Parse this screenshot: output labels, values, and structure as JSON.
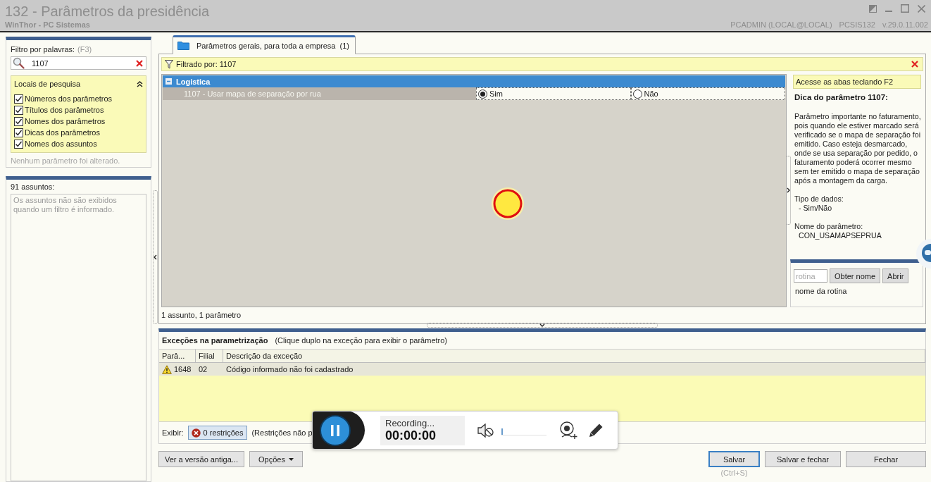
{
  "window": {
    "title": "132 - Parâmetros da presidência",
    "subtitle": "WinThor - PC Sistemas",
    "session": "PCADMIN (LOCAL@LOCAL)",
    "program": "PCSIS132",
    "version": "v.29.0.11.002"
  },
  "filter_panel": {
    "label": "Filtro por palavras:",
    "shortcut": "(F3)",
    "search": {
      "value": "1107"
    },
    "locations": {
      "title": "Locais de pesquisa",
      "expanded": true,
      "items": [
        {
          "label": "Números dos parâmetros",
          "checked": true
        },
        {
          "label": "Títulos dos parâmetros",
          "checked": true
        },
        {
          "label": "Nomes dos parâmetros",
          "checked": true
        },
        {
          "label": "Dicas dos parâmetros",
          "checked": true
        },
        {
          "label": "Nomes dos assuntos",
          "checked": true
        }
      ]
    },
    "status": "Nenhum parâmetro foi alterado."
  },
  "subjects_panel": {
    "count_label": "91 assuntos:",
    "placeholder": "Os assuntos não são exibidos quando um filtro é informado."
  },
  "tabs": [
    {
      "label": "Parâmetros gerais, para toda a empresa",
      "count": "(1)",
      "selected": true
    }
  ],
  "filter_bar": {
    "text": "Filtrado por: 1107"
  },
  "grid": {
    "groups": [
      {
        "name": "Logistica",
        "expanded": true,
        "rows": [
          {
            "label": "1107 - Usar mapa de separação por rua",
            "options": [
              {
                "label": "Sim",
                "selected": true
              },
              {
                "label": "Não",
                "selected": false
              }
            ]
          }
        ]
      }
    ],
    "summary": "1 assunto, 1 parâmetro"
  },
  "tip_panel": {
    "hint": "Acesse as abas teclando F2",
    "title": "Dica do parâmetro 1107:",
    "description": "Parâmetro importante no faturamento, pois quando ele estiver marcado será verificado se o mapa de separação foi emitido. Caso esteja desmarcado, onde se usa separação por pedido, o faturamento poderá ocorrer mesmo sem ter emitido o mapa de separação após a montagem da carga.",
    "data_type_label": "Tipo de dados:",
    "data_type": "- Sim/Não",
    "name_label": "Nome do parâmetro:",
    "name": "CON_USAMAPSEPRUA"
  },
  "routine": {
    "placeholder": "rotina",
    "buttons": [
      "Obter nome",
      "Abrir"
    ],
    "result": "nome da rotina"
  },
  "exceptions": {
    "title": "Exceções na parametrização",
    "hint": "(Clique duplo na exceção para exibir o parâmetro)",
    "columns": [
      "Parâ...",
      "Filial",
      "Descrição da exceção"
    ],
    "rows": [
      {
        "kind": "warning",
        "selected": true,
        "cells": [
          "1648",
          "02",
          "Código informado não foi cadastrado"
        ]
      }
    ],
    "show_label": "Exibir:",
    "restrictions_button": "0 restrições",
    "restrictions_note": "(Restrições não p"
  },
  "footer": {
    "left_buttons": [
      {
        "label": "Ver a versão antiga...",
        "kind": "plain"
      },
      {
        "label": "Opções",
        "kind": "dropdown"
      }
    ],
    "right_buttons": [
      {
        "label": "Salvar",
        "focused": true,
        "shortcut": "(Ctrl+S)"
      },
      {
        "label": "Salvar e fechar",
        "focused": false
      },
      {
        "label": "Fechar",
        "focused": false
      }
    ]
  },
  "recorder": {
    "status": "Recording...",
    "time": "00:00:00",
    "volume": {
      "level": 0
    }
  }
}
